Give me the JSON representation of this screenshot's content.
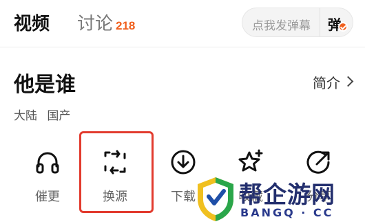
{
  "tabs": {
    "video_label": "视频",
    "discuss_label": "讨论",
    "discuss_count": "218"
  },
  "danmaku": {
    "placeholder": "点我发弹幕",
    "button_label": "弹"
  },
  "video": {
    "title": "他是谁",
    "intro_label": "简介",
    "tags": [
      "大陆",
      "国产"
    ]
  },
  "actions": [
    {
      "label": "催更",
      "icon": "headphones-icon"
    },
    {
      "label": "换源",
      "icon": "switch-source-icon"
    },
    {
      "label": "下载",
      "icon": "download-icon"
    },
    {
      "label": "收藏",
      "icon": "star-add-icon"
    },
    {
      "label": "分享",
      "icon": "share-icon"
    }
  ],
  "watermark": {
    "brand": "帮企游网",
    "domain": "BANGQ · CC"
  },
  "colors": {
    "accent": "#f0601e",
    "highlight_border": "#e23b2e",
    "watermark_navy": "#232f6e"
  }
}
